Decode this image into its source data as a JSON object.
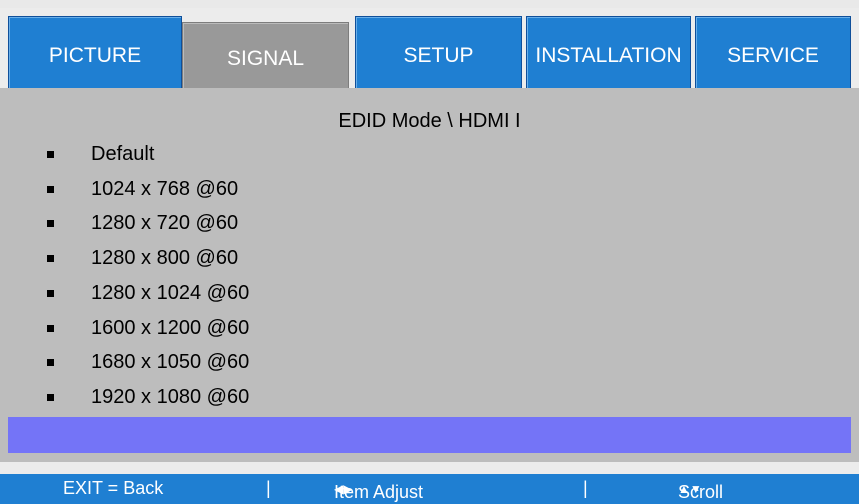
{
  "tabs": [
    {
      "label": "PICTURE",
      "active": false
    },
    {
      "label": "SIGNAL",
      "active": true
    },
    {
      "label": "SETUP",
      "active": false
    },
    {
      "label": "INSTALLATION",
      "active": false
    },
    {
      "label": "SERVICE",
      "active": false
    }
  ],
  "panel": {
    "title": "EDID Mode \\ HDMI I",
    "items": [
      "Default",
      "1024 x 768 @60",
      "1280 x 720 @60",
      "1280 x 800 @60",
      "1280 x 1024 @60",
      "1600 x 1200 @60",
      "1680 x 1050 @60",
      "1920 x 1080 @60"
    ]
  },
  "footer": {
    "exit_hint": "EXIT = Back",
    "separator": "|",
    "adjust_hint": "Item Adjust",
    "adjust_arrows": "◀▶",
    "scroll_hint": "Scroll",
    "scroll_arrows": "▲▼"
  },
  "colors": {
    "tab_blue": "#1f7fd2",
    "tab_active_gray": "#999999",
    "panel_gray": "#bdbdbd",
    "selection_purple": "#7474f7",
    "footer_blue": "#1f7fd2"
  },
  "icons": {
    "bullet": "square-bullet-icon",
    "adjust": "left-right-arrow-icon",
    "scroll": "up-down-arrow-icon"
  }
}
